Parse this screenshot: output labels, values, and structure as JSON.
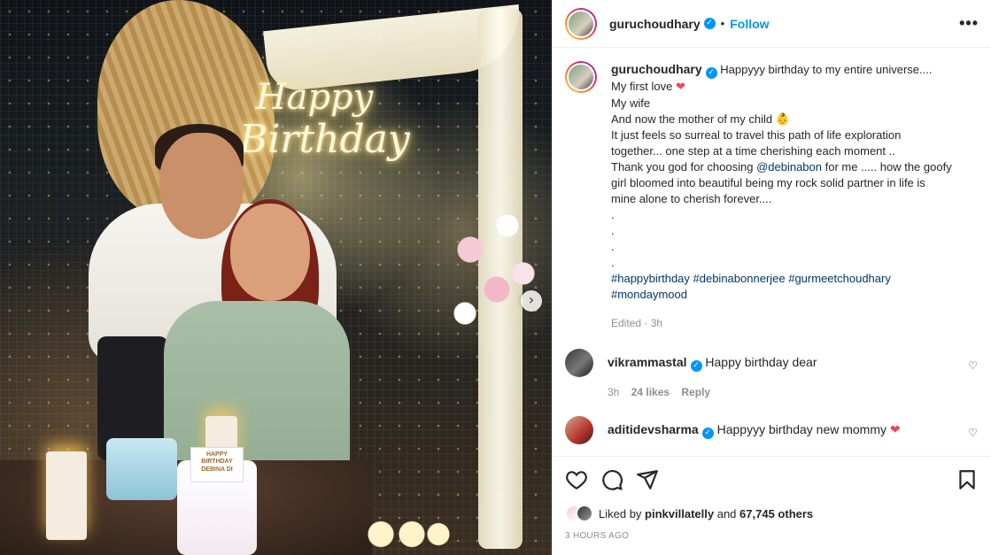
{
  "photo": {
    "neon_line1": "Happy",
    "neon_line2": "Birthday",
    "cake_card": "HAPPY BIRTHDAY DEBINA DI"
  },
  "header": {
    "username": "guruchoudhary",
    "separator": "•",
    "follow_label": "Follow",
    "more_label": "•••"
  },
  "caption": {
    "username": "guruchoudhary",
    "lines": [
      "Happyyy birthday to my entire universe....",
      "My first love",
      "My wife",
      "And now the mother of my child",
      "It just feels so surreal to travel this path of life exploration",
      "together... one step at a time cherishing each moment ..",
      "Thank you god for choosing",
      "@debinabon",
      "for me ..... how the goofy",
      "girl bloomed into beautiful being my rock solid partner in life is",
      "mine alone to cherish forever....",
      ".",
      ".",
      ".",
      "."
    ],
    "heart_emoji": "❤",
    "baby_emoji": "👶",
    "hashtags_line1": "#happybirthday #debinabonnerjee #gurmeetchoudhary",
    "hashtags_line2": "#mondaymood",
    "meta": "Edited · 3h"
  },
  "comments": [
    {
      "username": "vikrammastal",
      "text": "Happy birthday dear",
      "time": "3h",
      "likes": "24 likes",
      "reply": "Reply"
    },
    {
      "username": "aditidevsharma",
      "text": "Happyyy birthday new mommy",
      "emoji": "❤"
    }
  ],
  "likes": {
    "prefix": "Liked by",
    "user": "pinkvillatelly",
    "and": "and",
    "others": "67,745 others"
  },
  "time_ago": "3 HOURS AGO",
  "colors": {
    "link": "#0095f6",
    "hashtag": "#00376b",
    "muted": "#8e8e8e",
    "heart": "#ed4956"
  },
  "icons": [
    "heart-icon",
    "comment-icon",
    "share-icon",
    "bookmark-icon",
    "more-icon",
    "verified-icon",
    "chevron-right-icon"
  ]
}
